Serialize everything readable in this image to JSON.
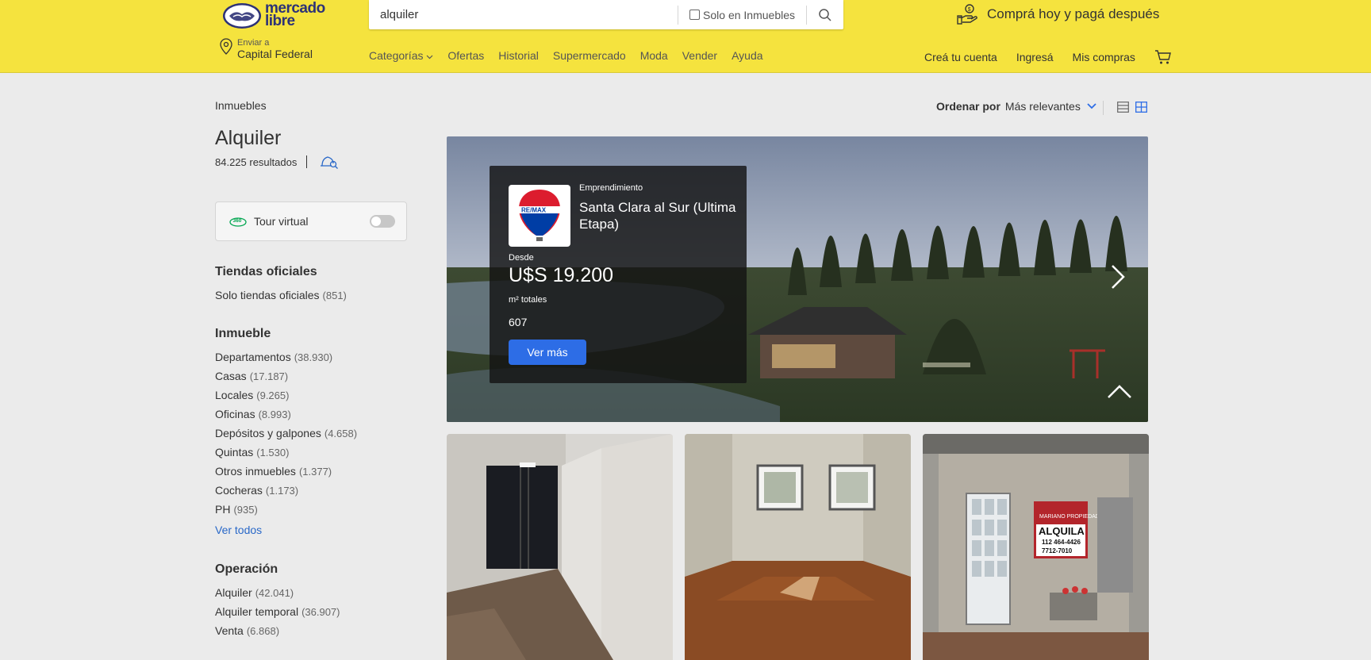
{
  "header": {
    "logo_text_line1": "mercado",
    "logo_text_line2": "libre",
    "search_value": "alquiler",
    "search_filter_label": "Solo en Inmuebles",
    "promo_text": "Comprá hoy y pagá después",
    "location_label": "Enviar a",
    "location_value": "Capital Federal",
    "nav": [
      "Categorías",
      "Ofertas",
      "Historial",
      "Supermercado",
      "Moda",
      "Vender",
      "Ayuda"
    ],
    "account_nav": [
      "Creá tu cuenta",
      "Ingresá",
      "Mis compras"
    ]
  },
  "sidebar": {
    "breadcrumb": "Inmuebles",
    "title": "Alquiler",
    "results": "84.225 resultados",
    "tour_virtual": "Tour virtual",
    "tour_badge": "360",
    "groups": [
      {
        "title": "Tiendas oficiales",
        "items": [
          {
            "label": "Solo tiendas oficiales",
            "count": "(851)"
          }
        ]
      },
      {
        "title": "Inmueble",
        "items": [
          {
            "label": "Departamentos",
            "count": "(38.930)"
          },
          {
            "label": "Casas",
            "count": "(17.187)"
          },
          {
            "label": "Locales",
            "count": "(9.265)"
          },
          {
            "label": "Oficinas",
            "count": "(8.993)"
          },
          {
            "label": "Depósitos y galpones",
            "count": "(4.658)"
          },
          {
            "label": "Quintas",
            "count": "(1.530)"
          },
          {
            "label": "Otros inmuebles",
            "count": "(1.377)"
          },
          {
            "label": "Cocheras",
            "count": "(1.173)"
          },
          {
            "label": "PH",
            "count": "(935)"
          }
        ],
        "view_all": "Ver todos"
      },
      {
        "title": "Operación",
        "items": [
          {
            "label": "Alquiler",
            "count": "(42.041)"
          },
          {
            "label": "Alquiler temporal",
            "count": "(36.907)"
          },
          {
            "label": "Venta",
            "count": "(6.868)"
          }
        ]
      }
    ]
  },
  "sort": {
    "label": "Ordenar por",
    "value": "Más relevantes"
  },
  "banner": {
    "brand": "RE/MAX",
    "tag": "Emprendimiento",
    "name": "Santa Clara al Sur (Ultima Etapa)",
    "price_label": "Desde",
    "price": "U$S 19.200",
    "area_label": "m² totales",
    "area_value": "607",
    "button": "Ver más"
  },
  "listing_cards": [
    {
      "sign_title": "",
      "sign_lines": []
    },
    {
      "sign_title": "",
      "sign_lines": []
    },
    {
      "sign_title": "ALQUILA",
      "sign_header": "MARIANO PROPIEDADES",
      "sign_lines": [
        "112 464-4426",
        "7712-7010"
      ]
    }
  ],
  "colors": {
    "header_yellow": "#f5e33e",
    "primary_blue": "#2d6de6",
    "link_blue": "#2968c8"
  }
}
